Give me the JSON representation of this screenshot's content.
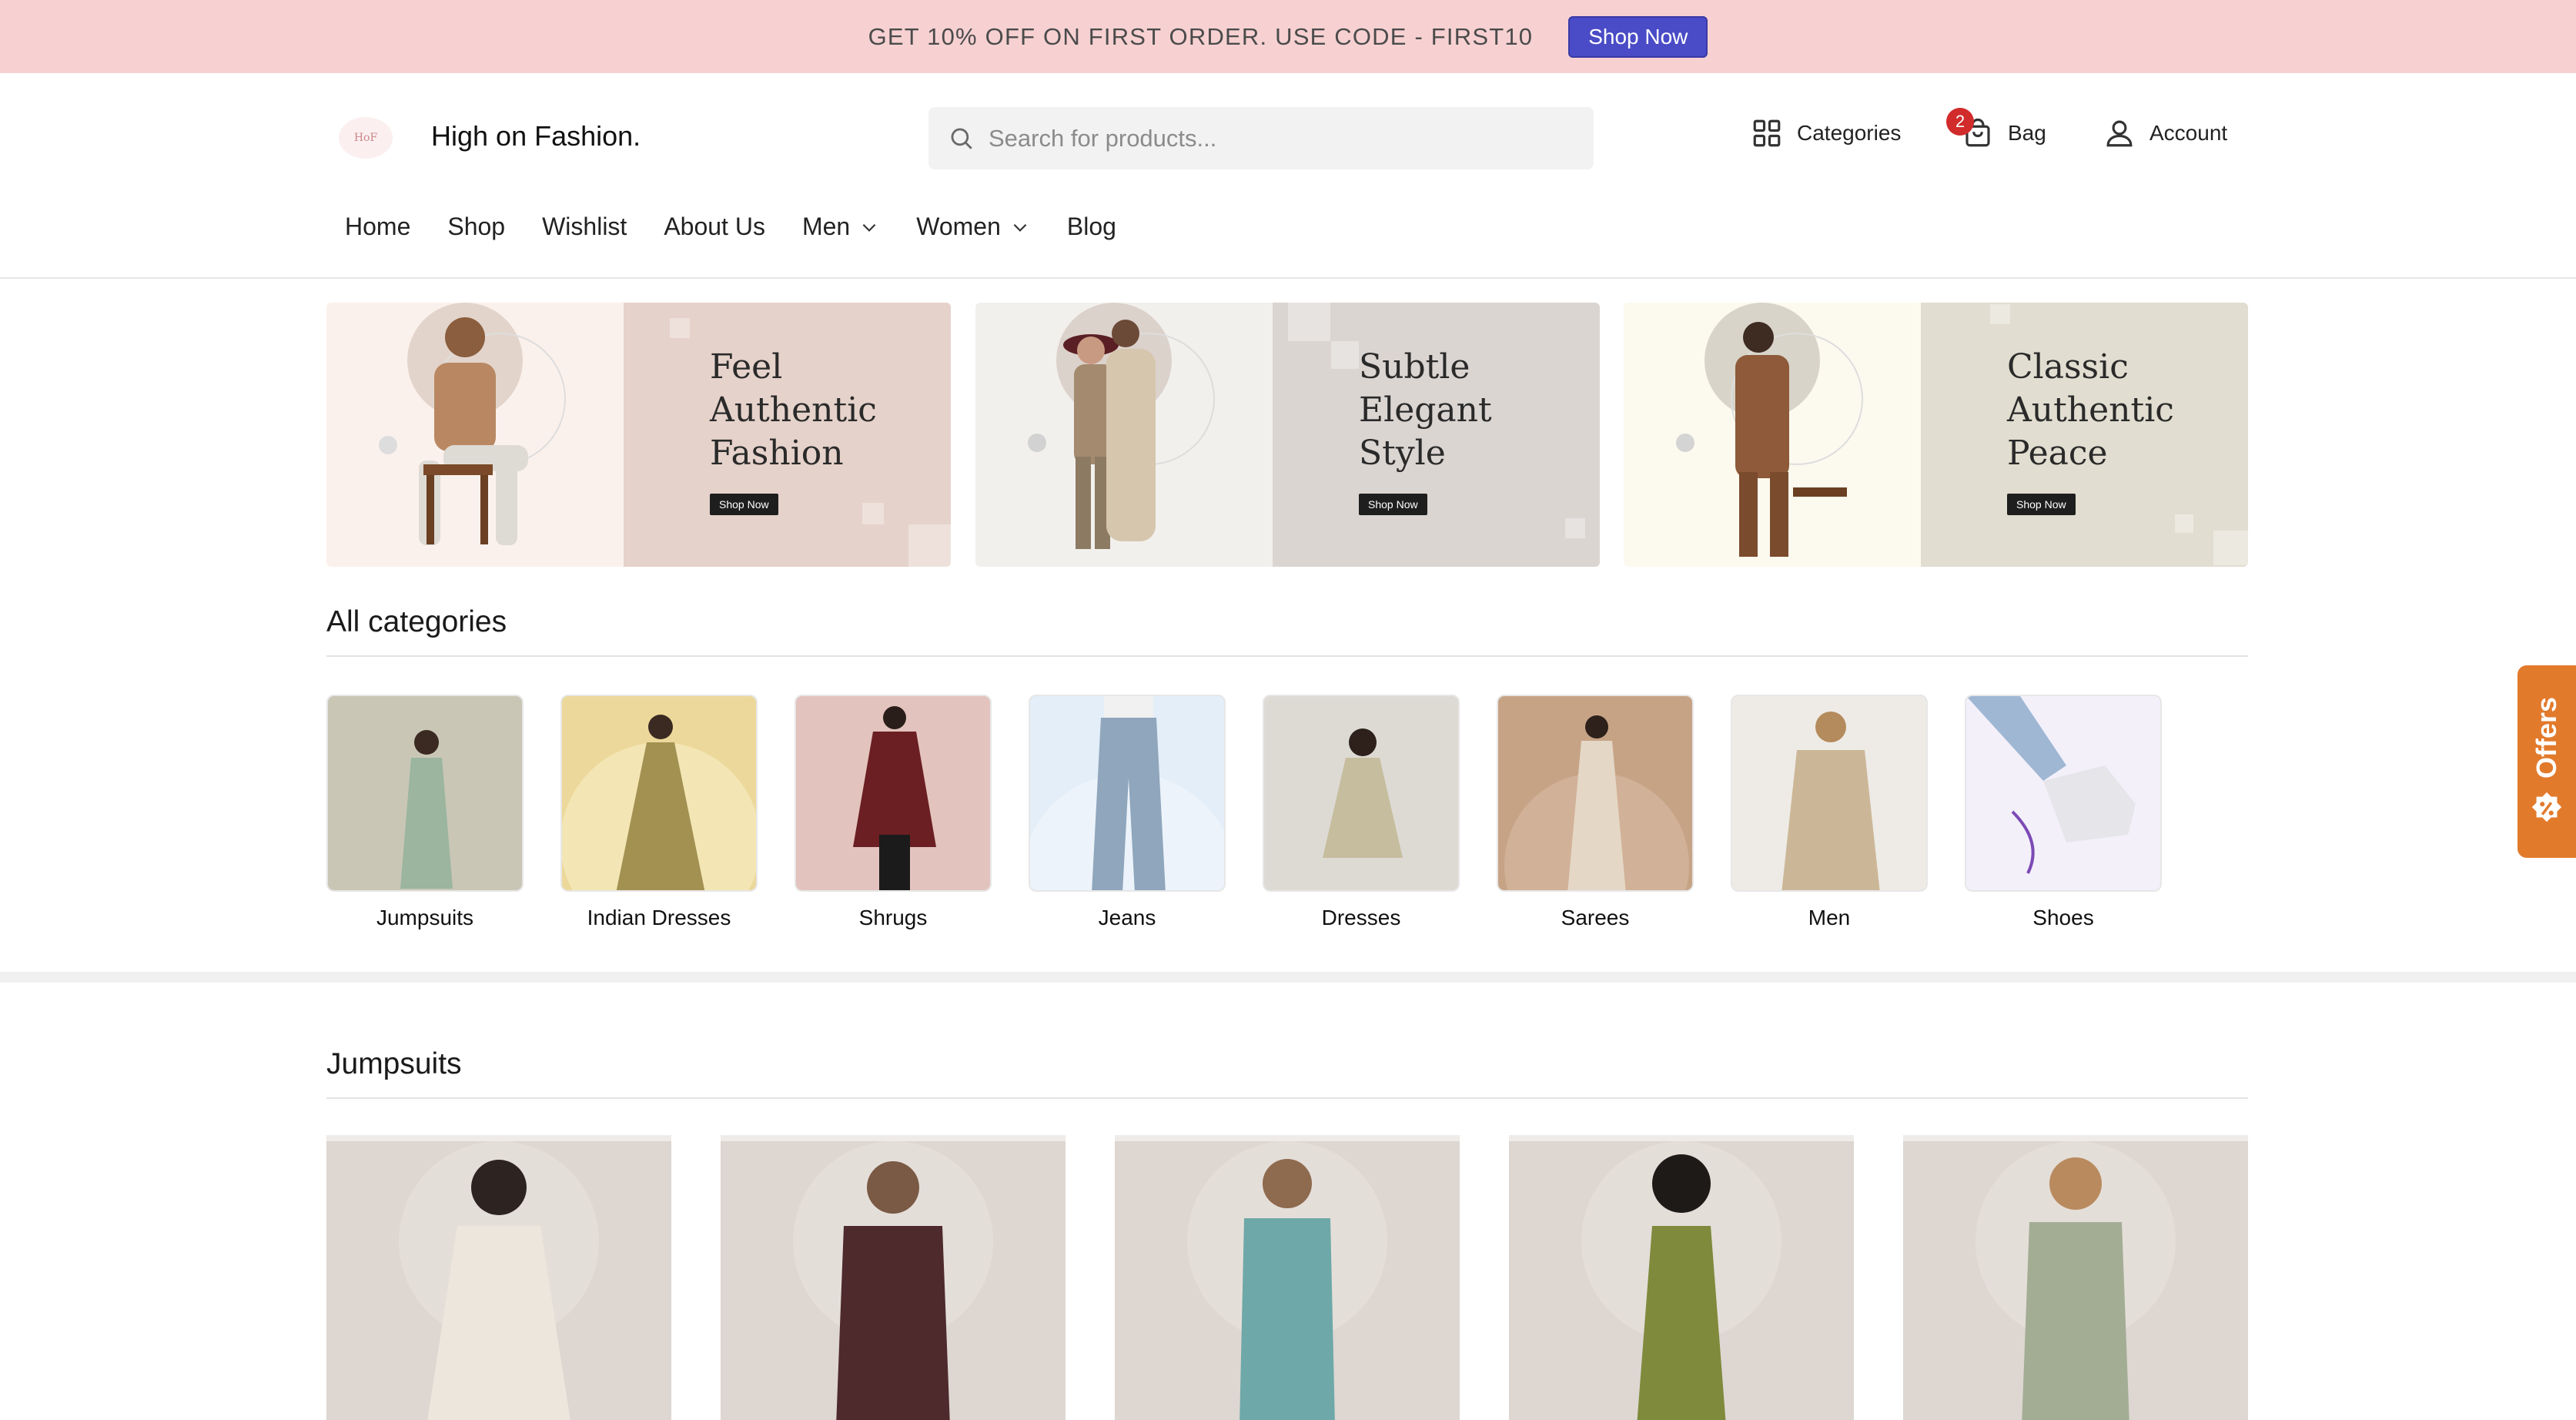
{
  "promo": {
    "text": "GET 10% OFF ON FIRST ORDER. USE CODE - FIRST10",
    "button": "Shop Now"
  },
  "header": {
    "logo_text": "HoF",
    "brand": "High on Fashion.",
    "search_placeholder": "Search for products...",
    "categories": "Categories",
    "bag": "Bag",
    "bag_count": "2",
    "account": "Account"
  },
  "nav": [
    "Home",
    "Shop",
    "Wishlist",
    "About Us",
    "Men",
    "Women",
    "Blog"
  ],
  "banners": [
    {
      "title": "Feel\nAuthentic\nFashion",
      "button": "Shop Now"
    },
    {
      "title": "Subtle\nElegant\nStyle",
      "button": "Shop Now"
    },
    {
      "title": "Classic\nAuthentic\nPeace",
      "button": "Shop Now"
    }
  ],
  "categories_section": {
    "title": "All categories",
    "items": [
      "Jumpsuits",
      "Indian Dresses",
      "Shrugs",
      "Jeans",
      "Dresses",
      "Sarees",
      "Men",
      "Shoes"
    ]
  },
  "jumpsuits_section": {
    "title": "Jumpsuits"
  },
  "offers_tab": {
    "label": "Offers"
  },
  "colors": {
    "promo_bg": "#f7d1d2",
    "promo_button": "#4a4bc6",
    "offers_tab": "#e27a2c",
    "badge": "#d12b2b"
  }
}
